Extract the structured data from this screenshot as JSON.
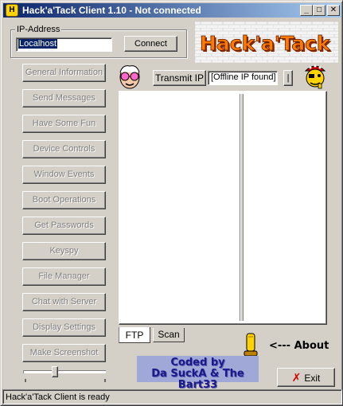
{
  "window": {
    "title": "Hack'a'Tack Client 1.10 - Not connected",
    "title_icon_glyph": "H",
    "minimize_glyph": "_",
    "maximize_glyph": "□",
    "close_glyph": "✕"
  },
  "connection": {
    "group_label": "IP-Address",
    "ip_value": "Localhost",
    "connect_label": "Connect"
  },
  "logo": {
    "text": "Hack'a'Tack"
  },
  "left_menu": [
    {
      "label": "General Information"
    },
    {
      "label": "Send Messages"
    },
    {
      "label": "Have Some Fun"
    },
    {
      "label": "Device Controls"
    },
    {
      "label": "Window Events"
    },
    {
      "label": "Boot Operations"
    },
    {
      "label": "Get Passwords"
    },
    {
      "label": "Keyspy"
    },
    {
      "label": "File Manager"
    },
    {
      "label": "Chat with Server"
    },
    {
      "label": "Display Settings"
    },
    {
      "label": "Make Screenshot"
    }
  ],
  "transmit": {
    "button_label": "Transmit IP",
    "status_value": "[Offline IP found]",
    "small_button_label": "|"
  },
  "tabs": [
    {
      "label": "FTP",
      "active": true
    },
    {
      "label": "Scan",
      "active": false
    }
  ],
  "credits": {
    "line1": "Coded by",
    "line2": "Da SuckA & The Bart33"
  },
  "about": {
    "label": "<--- About"
  },
  "exit_button": {
    "label": "Exit",
    "icon": "red-x-icon"
  },
  "status": {
    "text": "Hack'a'Tack Client is ready"
  },
  "colors": {
    "titlebar_start": "#0a246a",
    "titlebar_end": "#a6caf0",
    "credits_bg": "#a0a8d8",
    "logo_orange": "#ff7a00"
  },
  "icons": [
    "professor-face-icon",
    "pirate-face-icon",
    "figure-icon",
    "red-x-icon"
  ],
  "slider": {
    "value_fraction": 0.38
  }
}
